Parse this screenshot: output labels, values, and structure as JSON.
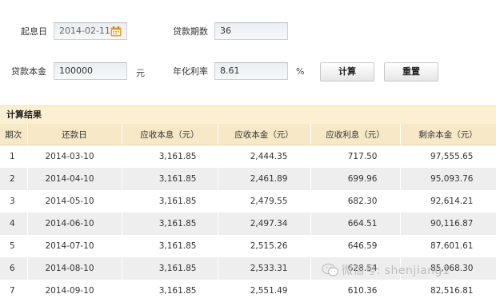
{
  "form": {
    "start_date_label": "起息日",
    "start_date_value": "2014-02-11",
    "term_label": "贷款期数",
    "term_value": "36",
    "principal_label": "贷款本金",
    "principal_value": "100000",
    "principal_unit": "元",
    "rate_label": "年化利率",
    "rate_value": "8.61",
    "rate_unit": "%",
    "calculate_label": "计算",
    "reset_label": "重置"
  },
  "results": {
    "title": "计算结果",
    "columns": [
      "期次",
      "还款日",
      "应收本息（元）",
      "应收本金（元）",
      "应收利息（元）",
      "剩余本金（元）"
    ],
    "rows": [
      [
        "1",
        "2014-03-10",
        "3,161.85",
        "2,444.35",
        "717.50",
        "97,555.65"
      ],
      [
        "2",
        "2014-04-10",
        "3,161.85",
        "2,461.89",
        "699.96",
        "95,093.76"
      ],
      [
        "3",
        "2014-05-10",
        "3,161.85",
        "2,479.55",
        "682.30",
        "92,614.21"
      ],
      [
        "4",
        "2014-06-10",
        "3,161.85",
        "2,497.34",
        "664.51",
        "90,116.87"
      ],
      [
        "5",
        "2014-07-10",
        "3,161.85",
        "2,515.26",
        "646.59",
        "87,601.61"
      ],
      [
        "6",
        "2014-08-10",
        "3,161.85",
        "2,533.31",
        "628.54",
        "85,068.30"
      ],
      [
        "7",
        "2014-09-10",
        "3,161.85",
        "2,551.49",
        "610.36",
        "82,516.81"
      ]
    ]
  },
  "watermark": {
    "text": "微信号: shenjiang1"
  },
  "colors": {
    "header_bg": "#f7e9c7",
    "title_bg": "#fdf0d2",
    "calendar_icon": "#f0a020"
  }
}
